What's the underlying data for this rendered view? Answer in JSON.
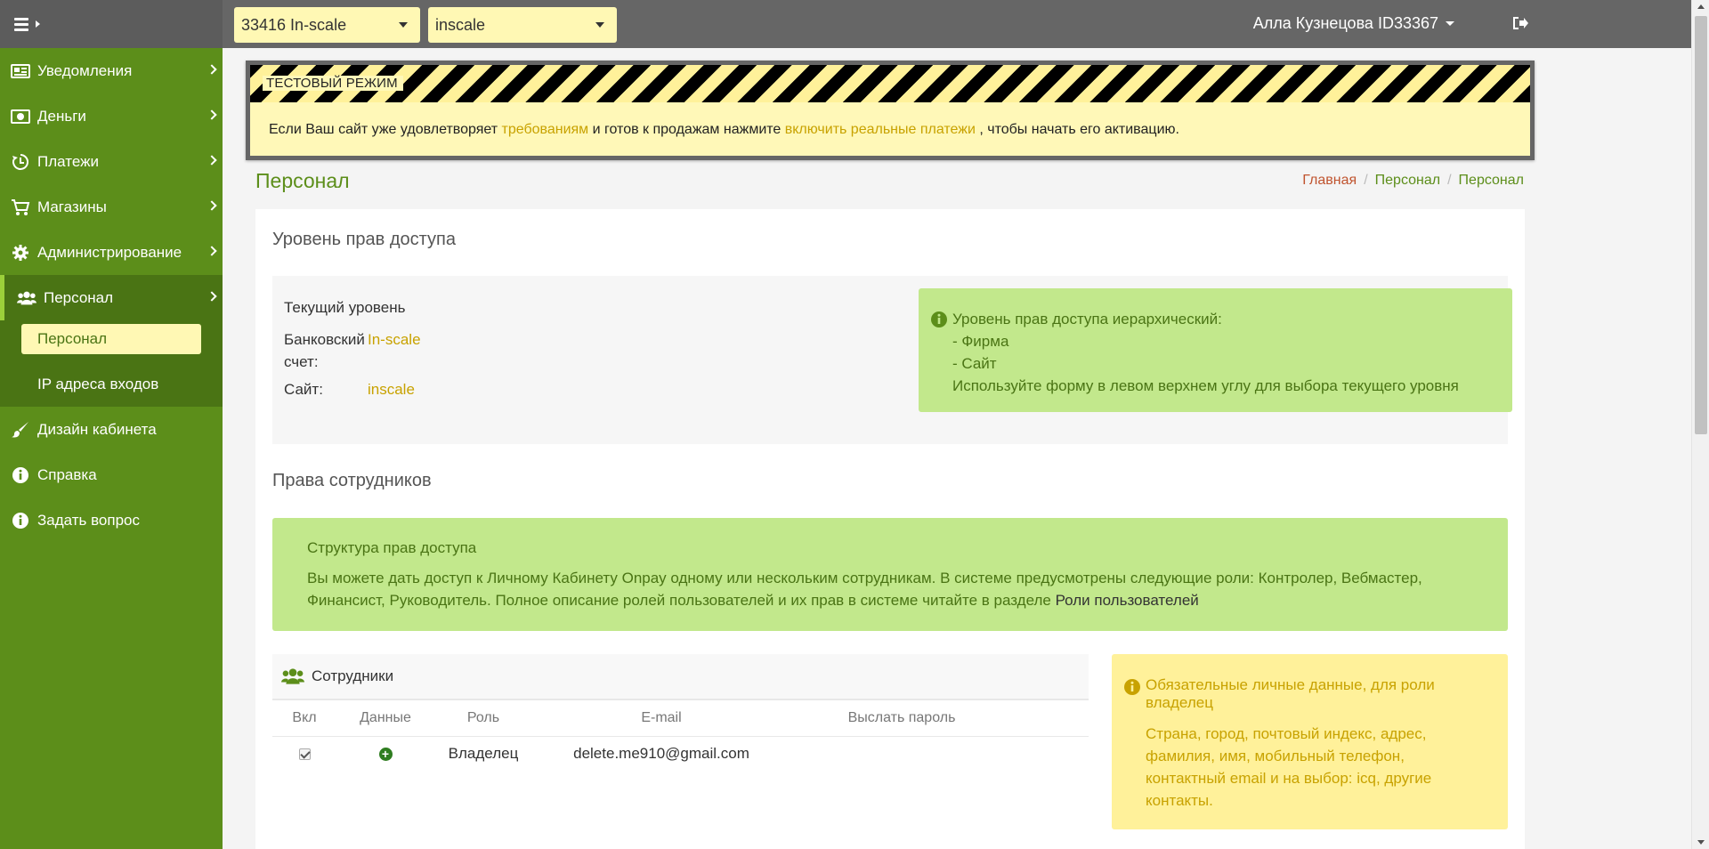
{
  "topbar": {
    "account_select": "33416 In-scale",
    "site_select": "inscale",
    "user": "Алла Кузнецова ID33367"
  },
  "sidebar": {
    "items": [
      {
        "label": "Уведомления",
        "icon": "newspaper-icon"
      },
      {
        "label": "Деньги",
        "icon": "money-icon"
      },
      {
        "label": "Платежи",
        "icon": "history-icon"
      },
      {
        "label": "Магазины",
        "icon": "cart-icon"
      },
      {
        "label": "Администрирование",
        "icon": "gear-icon"
      },
      {
        "label": "Персонал",
        "icon": "users-icon"
      },
      {
        "label": "Дизайн кабинета",
        "icon": "brush-icon"
      },
      {
        "label": "Справка",
        "icon": "info-icon"
      },
      {
        "label": "Задать вопрос",
        "icon": "info-icon"
      }
    ],
    "subitems": [
      {
        "label": "Персонал"
      },
      {
        "label": "IP адреса входов"
      }
    ]
  },
  "banner": {
    "label": "ТЕСТОВЫЙ РЕЖИМ",
    "text_before": "Если Ваш сайт уже удовлетворяет ",
    "link1": "требованиям",
    "text_middle": " и готов к продажам нажмите ",
    "link2": "включить реальные платежи",
    "text_after": " , чтобы начать его активацию."
  },
  "page": {
    "title": "Персонал",
    "breadcrumb": [
      "Главная",
      "Персонал",
      "Персонал"
    ]
  },
  "access": {
    "section_title": "Уровень прав доступа",
    "current_level": "Текущий уровень",
    "bank_label": "Банковский счет:",
    "bank_value": "In-scale",
    "site_label": "Сайт:",
    "site_value": "inscale",
    "info_lines": [
      "Уровень прав доступа иерархический:",
      "- Фирма",
      "- Сайт",
      "Используйте форму в левом верхнем углу для выбора текущего уровня"
    ]
  },
  "rights": {
    "section_title": "Права сотрудников",
    "box_title": "Структура прав доступа",
    "box_text": "Вы можете дать доступ к Личному Кабинету Onpay одному или нескольким сотрудникам. В системе предусмотрены следующие роли: Контролер, Вебмастер, Финансист, Руководитель. Полное описание ролей пользователей и их прав в системе читайте в разделе ",
    "box_link": "Роли пользователей"
  },
  "staff": {
    "title": "Сотрудники",
    "columns": [
      "Вкл",
      "Данные",
      "Роль",
      "E-mail",
      "Выслать пароль"
    ],
    "rows": [
      {
        "enabled": true,
        "role": "Владелец",
        "email": "delete.me910@gmail.com"
      }
    ]
  },
  "required": {
    "title": "Обязательные личные данные, для роли владелец",
    "text": "Страна, город, почтовый индекс, адрес, фамилия, имя, мобильный телефон, контактный email и на выбор: icq, другие контакты."
  },
  "colors": {
    "sidebar": "#5c8e1a",
    "sidebar_active": "#4a7414",
    "accent_yellow": "#fff8b4",
    "info_green": "#c2e88c",
    "warn_yellow": "#fff19a",
    "link_gold": "#c8a200",
    "breadcrumb_home": "#c0542f"
  }
}
